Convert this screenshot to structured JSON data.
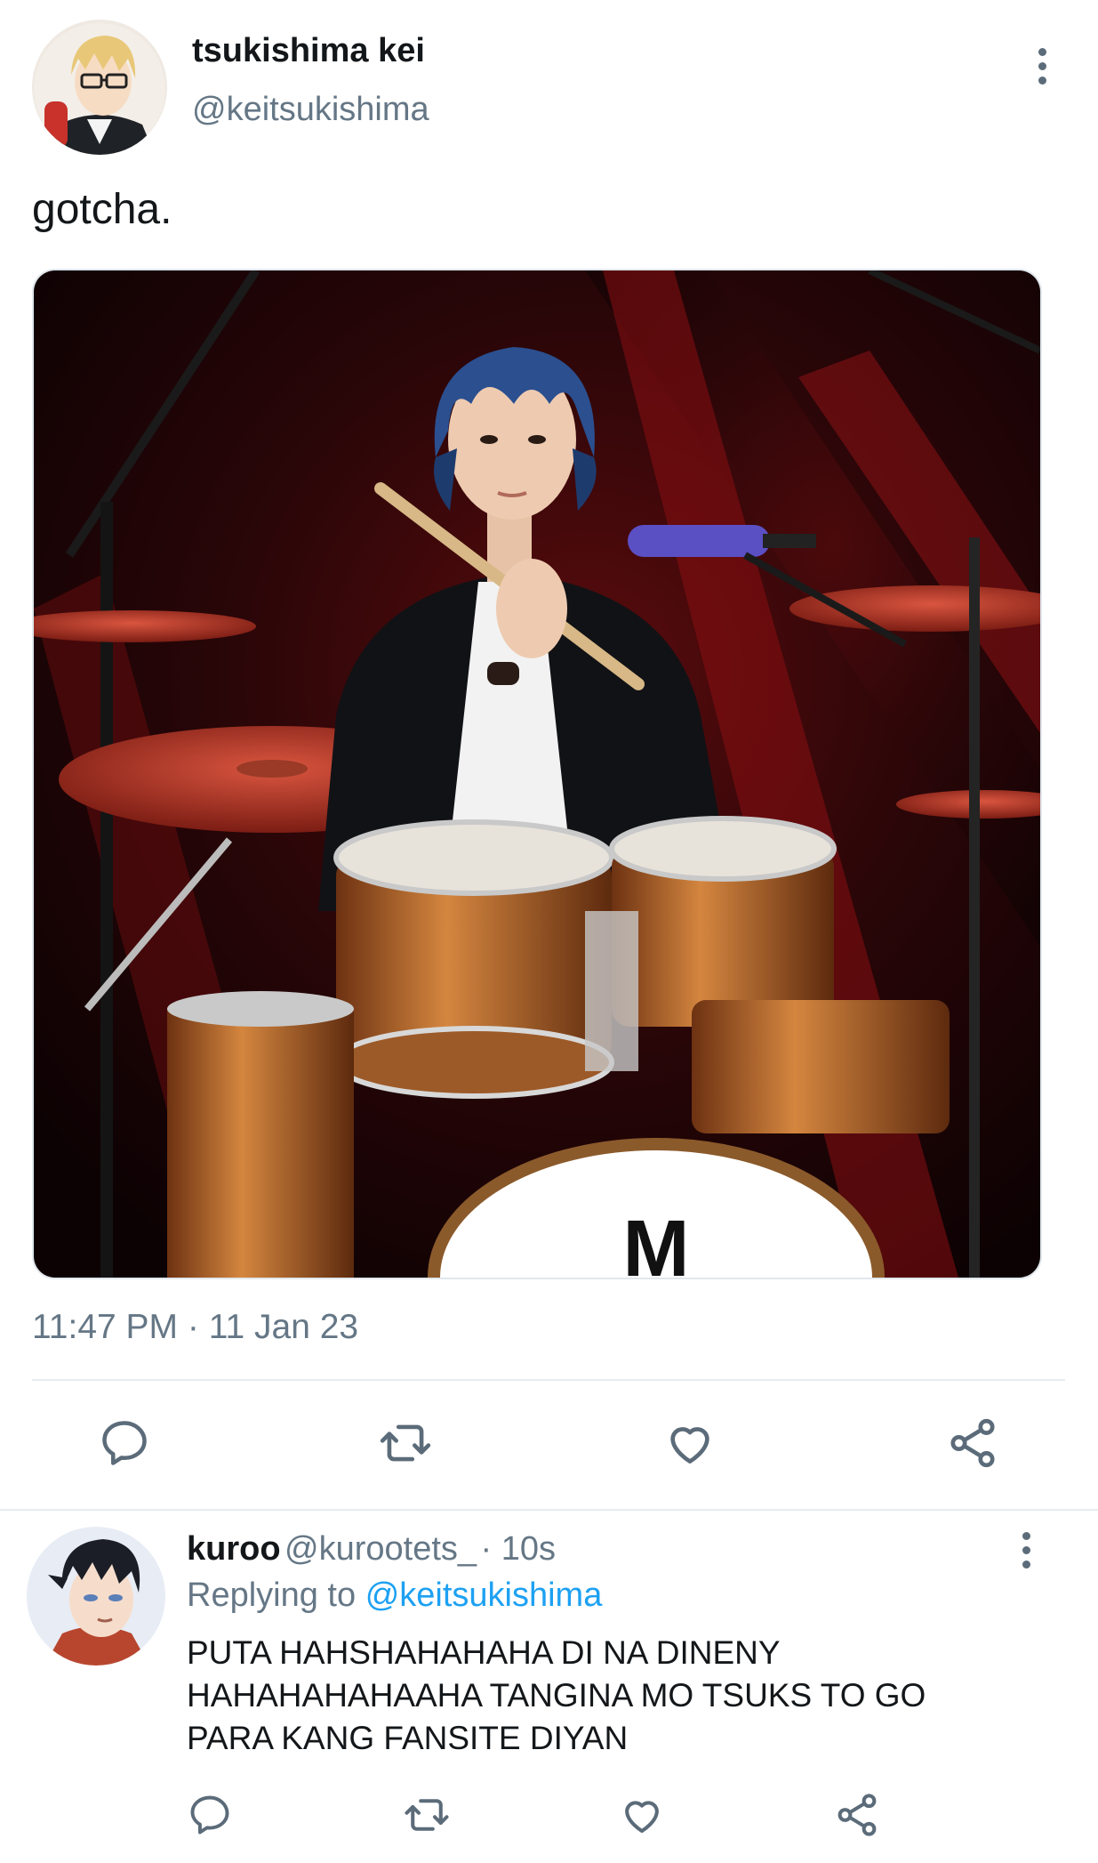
{
  "tweet": {
    "author": {
      "display_name": "tsukishima kei",
      "handle": "@keitsukishima",
      "avatar_icon": "anime-blonde-glasses-avatar"
    },
    "text": "gotcha.",
    "media": {
      "description": "photo of a drummer in a black suit holding a drumstick behind a drum kit on a red-lit stage",
      "bass_drum_logo": "M"
    },
    "timestamp": "11:47 PM · 11 Jan 23",
    "actions": [
      "reply-icon",
      "retweet-icon",
      "like-icon",
      "share-icon"
    ]
  },
  "reply": {
    "author": {
      "display_name": "kuroo",
      "handle": "@kurootets_",
      "time": "· 10s",
      "avatar_icon": "anime-black-hair-avatar"
    },
    "replying_label": "Replying to",
    "replying_to": "@keitsukishima",
    "text_lines": [
      "PUTA HAHSHAHAHAHA DI NA DINENY",
      "HAHAHAHAHAAHA TANGINA MO TSUKS TO GO",
      "PARA KANG FANSITE DIYAN"
    ],
    "actions": [
      "reply-icon",
      "retweet-icon",
      "like-icon",
      "share-icon"
    ]
  },
  "colors": {
    "text": "#14171a",
    "secondary": "#657786",
    "link": "#1da1f2",
    "icon": "#5b6b79",
    "divider": "#e6ecf0"
  }
}
